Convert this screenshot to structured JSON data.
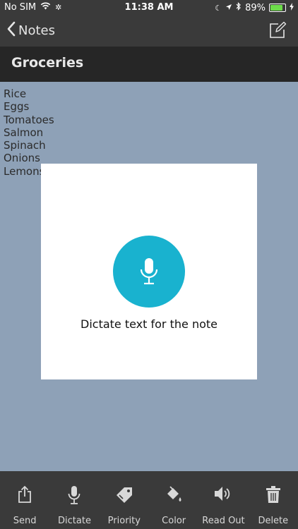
{
  "status_bar": {
    "carrier": "No SIM",
    "time": "11:38 AM",
    "battery_percent": "89%",
    "battery_level": 0.89,
    "battery_color": "#6ddc4a",
    "icons": [
      "wifi-icon",
      "activity-icon",
      "moon-icon",
      "location-arrow-icon",
      "bluetooth-icon",
      "battery-icon",
      "charging-bolt-icon"
    ]
  },
  "nav": {
    "back_label": "Notes",
    "back_icon": "chevron-left-icon",
    "compose_icon": "compose-icon"
  },
  "note": {
    "title": "Groceries",
    "lines": [
      "Rice",
      "Eggs",
      "Tomatoes",
      "Salmon",
      "Spinach",
      "Onions",
      "Lemons"
    ]
  },
  "dictation": {
    "label": "Dictate text for the note",
    "accent_color": "#19b2cf",
    "icon": "microphone-icon"
  },
  "toolbar": {
    "items": [
      {
        "label": "Send",
        "icon": "share-icon"
      },
      {
        "label": "Dictate",
        "icon": "microphone-icon"
      },
      {
        "label": "Priority",
        "icon": "tag-icon"
      },
      {
        "label": "Color",
        "icon": "paint-bucket-icon"
      },
      {
        "label": "Read Out",
        "icon": "speaker-icon"
      },
      {
        "label": "Delete",
        "icon": "trash-icon"
      }
    ]
  }
}
